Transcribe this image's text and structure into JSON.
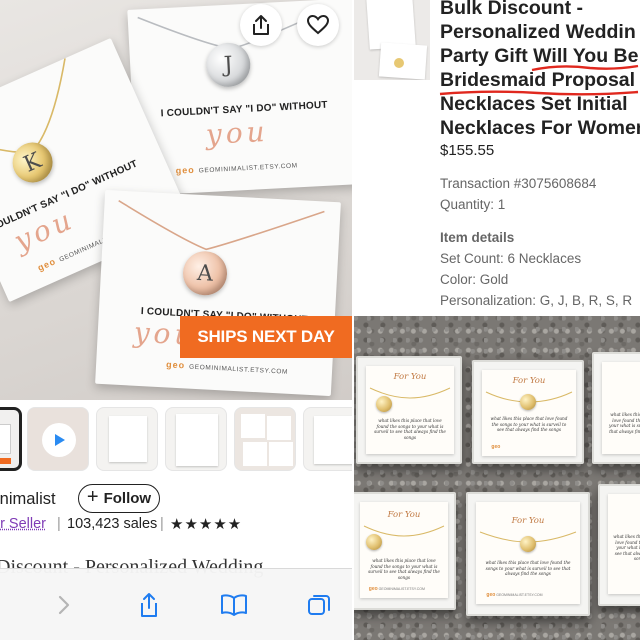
{
  "left_panel": {
    "hero": {
      "cards": [
        {
          "tagline": "I COULDN'T SAY \"I DO\" WITHOUT",
          "script": "you",
          "brand_mark": "geo",
          "brand_url": "GEOMINIMALIST.ETSY.COM",
          "initial": "J"
        },
        {
          "tagline": "I COULDN'T SAY \"I DO\" WITHOUT",
          "script": "you",
          "brand_mark": "geo",
          "brand_url": "GEOMINIMALIST",
          "initial": "K"
        },
        {
          "tagline": "I COULDN'T SAY \"I DO\" WITHOUT",
          "script": "you",
          "brand_mark": "geo",
          "brand_url": "GEOMINIMALIST.ETSY.COM",
          "initial": "A"
        }
      ],
      "badge": "SHIPS NEXT DAY",
      "share_icon": "share-icon",
      "favorite_icon": "heart-icon"
    },
    "thumbnails": [
      "listing-thumb",
      "video-thumb",
      "card-thumb",
      "info-thumb",
      "packaging-thumb",
      "card-detail-thumb"
    ],
    "seller": {
      "shop_name": "inimalist",
      "follow_label": "Follow",
      "star_seller": "ar Seller",
      "sales": "103,423 sales",
      "stars": "★★★★★",
      "rating": 5
    },
    "listing_title": "Discount - Personalized Wedding",
    "toolbar": {
      "icons": [
        "forward-icon",
        "share-icon",
        "bookmarks-icon",
        "tabs-icon"
      ]
    }
  },
  "order_panel": {
    "title_lines": [
      "Bulk Discount -",
      "Personalized Weddin",
      "Party Gift Will You Be",
      "Bridesmaid Proposal C",
      "Necklaces Set Initial",
      "Necklaces For Women"
    ],
    "price": "$155.55",
    "transaction": "Transaction #3075608684",
    "quantity": "Quantity: 1",
    "details_heading": "Item details",
    "details": [
      "Set Count: 6 Necklaces",
      "Color: Gold",
      "Personalization: G, J, B, R, S, R"
    ],
    "underline_color": "#e0281e"
  },
  "photo_panel": {
    "box_label": "For You",
    "card_text": "what likes this place that love found the songs to your what is surveil to see that always find the songs",
    "brand_mark": "geo",
    "brand_url": "GEOMINIMALIST.ETSY.COM"
  },
  "colors": {
    "badge": "#f06b21",
    "star_seller": "#7f3bb6",
    "script": "#e4a58d"
  }
}
